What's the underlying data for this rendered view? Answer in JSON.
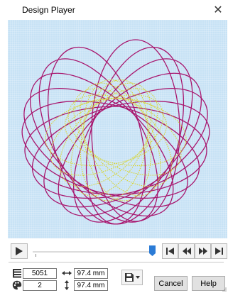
{
  "window": {
    "title": "Design Player",
    "close_symbol": "✕"
  },
  "canvas": {
    "background_color": "#c7e2f5",
    "outer_thread_color": "#a8166e",
    "inner_thread_color": "#d9d42b"
  },
  "player": {
    "progress": 1.0,
    "thumb_color": "#2b7bd6"
  },
  "info": {
    "stitches": "5051",
    "colors": "2",
    "width": "97.4 mm",
    "height": "97.4 mm"
  },
  "icons": {
    "stitches": "stitch-count-icon",
    "colors": "palette-icon",
    "width": "horizontal-arrow-icon",
    "height": "vertical-arrow-icon",
    "save": "floppy-disk-icon"
  },
  "buttons": {
    "cancel": "Cancel",
    "help": "Help"
  }
}
